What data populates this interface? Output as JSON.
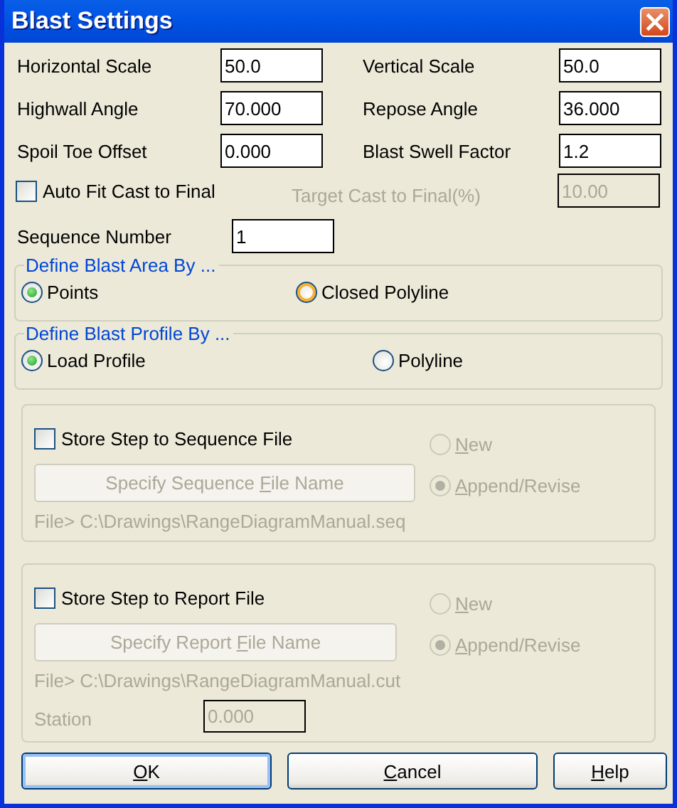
{
  "window": {
    "title": "Blast Settings"
  },
  "fields": [
    {
      "label": "Horizontal Scale",
      "value": "50.0"
    },
    {
      "label": "Vertical Scale",
      "value": "50.0"
    },
    {
      "label": "Highwall Angle",
      "value": "70.000"
    },
    {
      "label": "Repose Angle",
      "value": "36.000"
    },
    {
      "label": "Spoil Toe Offset",
      "value": "0.000"
    },
    {
      "label": "Blast Swell Factor",
      "value": "1.2"
    }
  ],
  "auto_fit": {
    "label": "Auto Fit Cast to Final",
    "checked": false
  },
  "target_cast": {
    "label": "Target Cast to Final(%)",
    "value": "10.00",
    "disabled": true
  },
  "sequence_number": {
    "label": "Sequence Number",
    "value": "1"
  },
  "groups": [
    {
      "legend": "Define Blast Area By ...",
      "options": [
        {
          "label": "Points",
          "selected": true
        },
        {
          "label": "Closed Polyline",
          "selected": false,
          "hovered": true
        }
      ]
    },
    {
      "legend": "Define Blast Profile By ...",
      "options": [
        {
          "label": "Load Profile",
          "selected": true
        },
        {
          "label": "Polyline",
          "selected": false
        }
      ]
    }
  ],
  "output_sections": [
    {
      "store": {
        "label": "Store Step to Sequence File",
        "checked": false
      },
      "file_button": {
        "pre": "Specify Sequence ",
        "key": "F",
        "post": "ile Name",
        "disabled": true
      },
      "modes": [
        {
          "key": "N",
          "post": "ew",
          "selected": false,
          "disabled": true
        },
        {
          "key": "A",
          "post": "ppend/Revise",
          "selected": true,
          "disabled": true
        }
      ],
      "file_path": "File> C:\\Drawings\\RangeDiagramManual.seq"
    },
    {
      "store": {
        "label": "Store Step to Report File",
        "checked": false
      },
      "file_button": {
        "pre": "Specify Report ",
        "key": "F",
        "post": "ile Name",
        "disabled": true
      },
      "modes": [
        {
          "key": "N",
          "post": "ew",
          "selected": false,
          "disabled": true
        },
        {
          "key": "A",
          "post": "ppend/Revise",
          "selected": true,
          "disabled": true
        }
      ],
      "file_path": "File> C:\\Drawings\\RangeDiagramManual.cut",
      "station": {
        "label": "Station",
        "value": "0.000",
        "disabled": true
      }
    }
  ],
  "buttons": [
    {
      "key": "O",
      "post": "K",
      "kind": "default"
    },
    {
      "key": "C",
      "post": "ancel",
      "kind": "normal"
    },
    {
      "key": "H",
      "post": "elp",
      "kind": "normal"
    }
  ]
}
